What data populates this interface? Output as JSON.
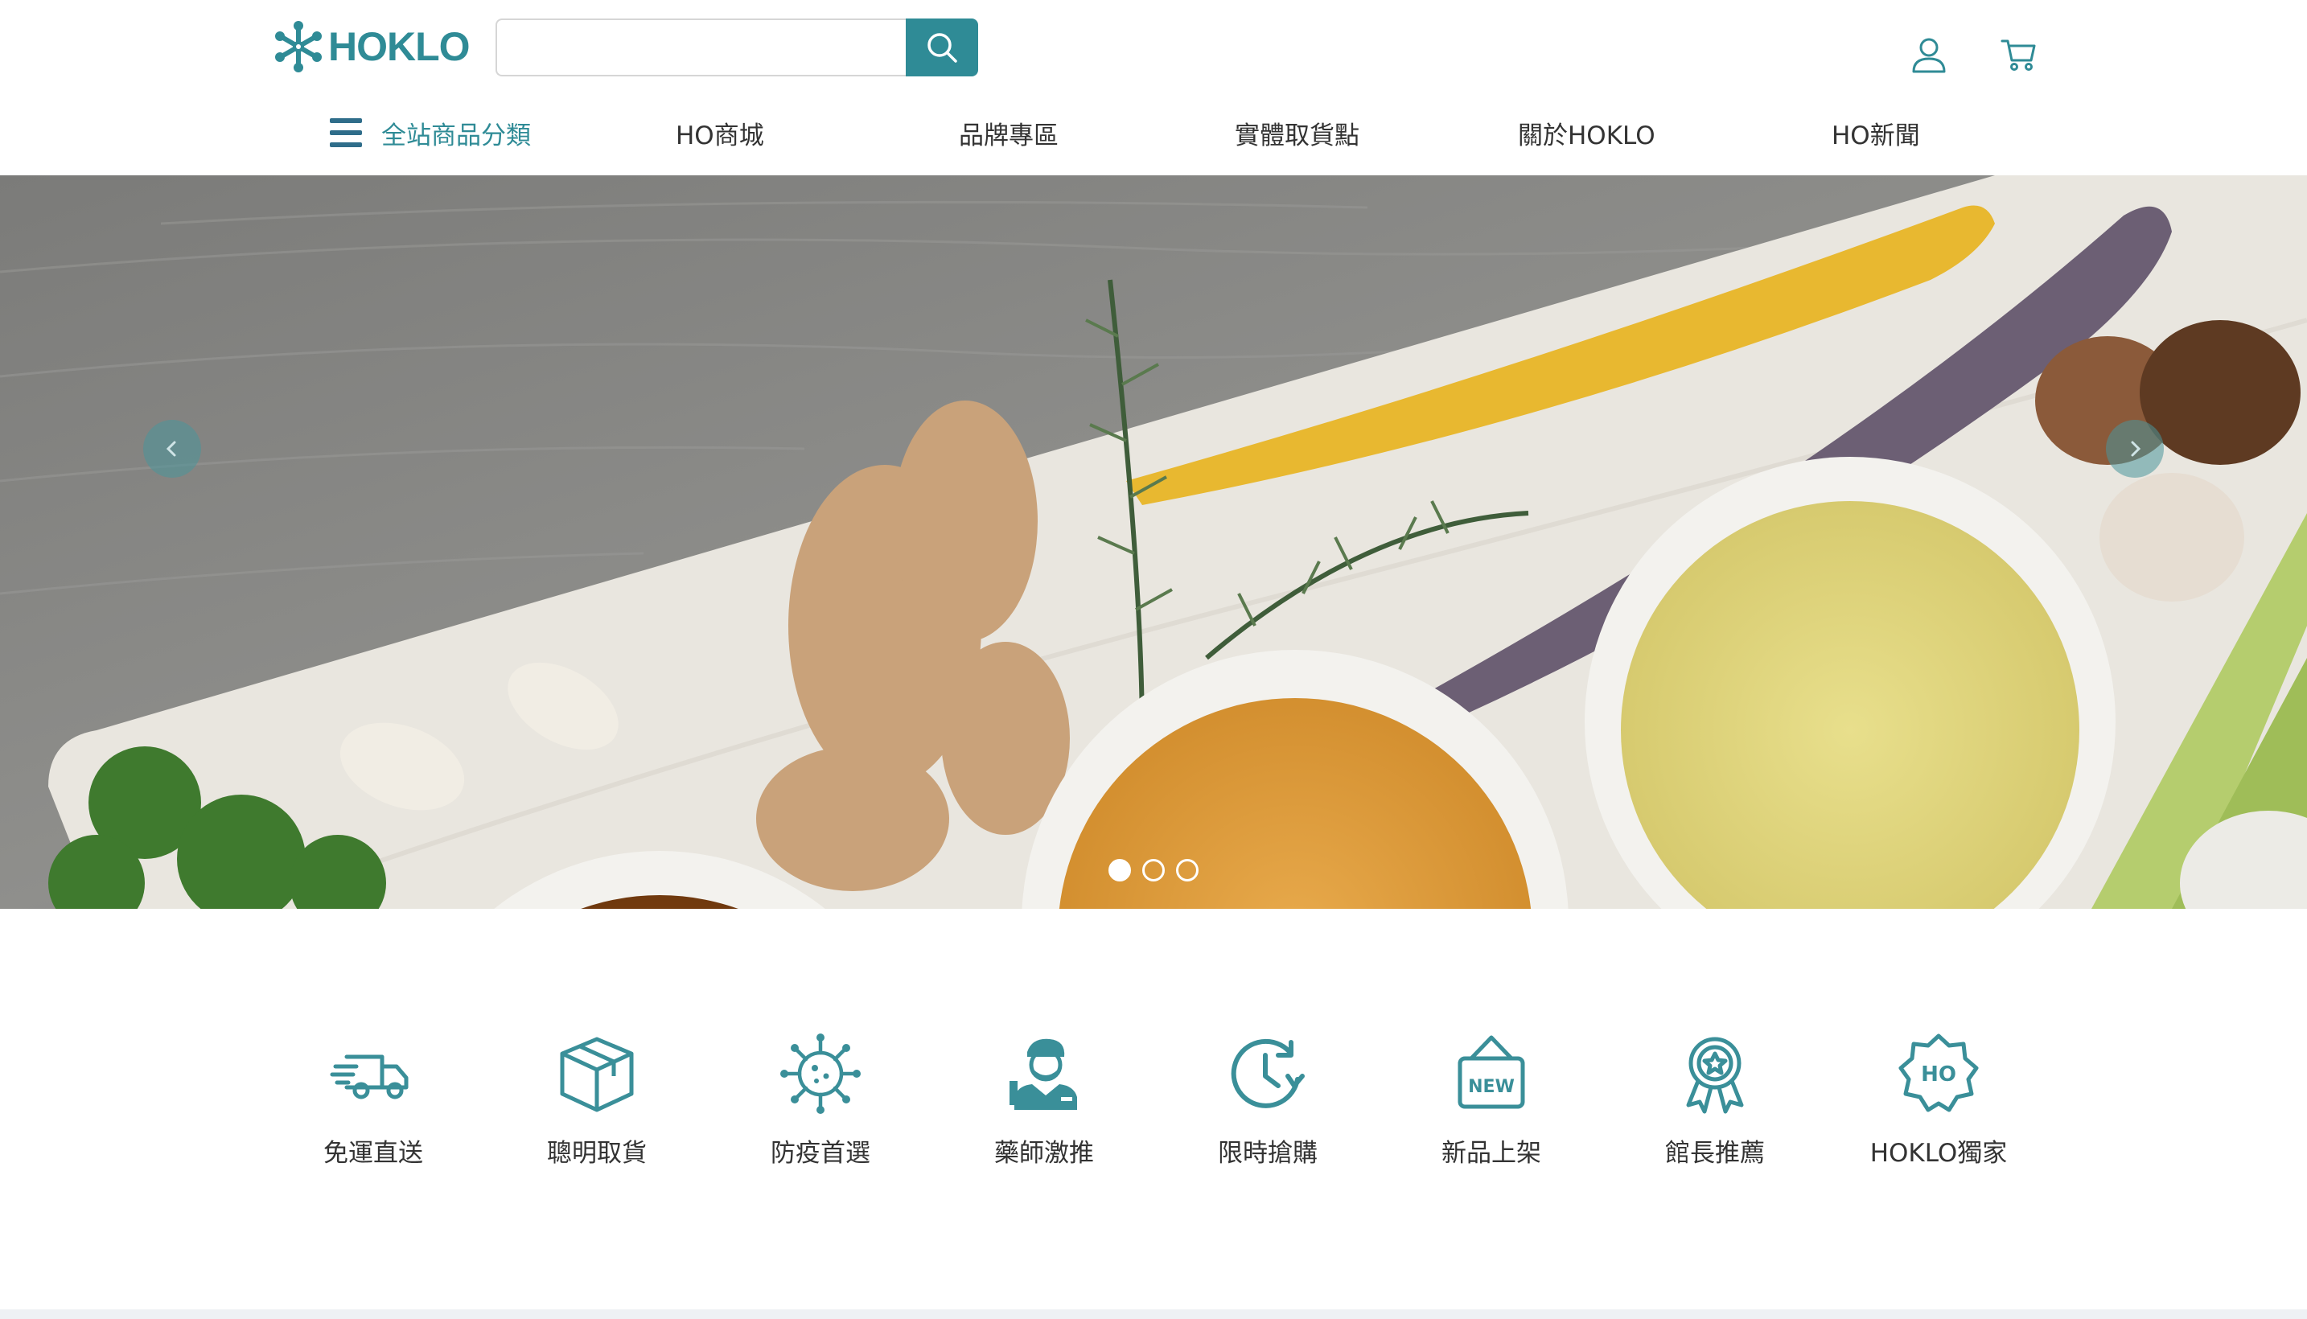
{
  "brand": {
    "name": "HOKLO",
    "accent": "#2f8b96"
  },
  "search": {
    "placeholder": "",
    "value": ""
  },
  "header_icons": [
    "user-icon",
    "cart-icon"
  ],
  "nav": {
    "categories_label": "全站商品分類",
    "items": [
      {
        "label": "HO商城"
      },
      {
        "label": "品牌專區"
      },
      {
        "label": "實體取貨點"
      },
      {
        "label": "關於HOKLO"
      },
      {
        "label": "HO新聞"
      }
    ]
  },
  "banner": {
    "slide_count": 3,
    "active_slide": 1
  },
  "features": [
    {
      "label": "免運直送",
      "icon": "delivery-truck-icon"
    },
    {
      "label": "聰明取貨",
      "icon": "package-box-icon"
    },
    {
      "label": "防疫首選",
      "icon": "virus-icon"
    },
    {
      "label": "藥師激推",
      "icon": "pharmacist-icon"
    },
    {
      "label": "限時搶購",
      "icon": "clock-icon"
    },
    {
      "label": "新品上架",
      "icon": "new-tag-icon"
    },
    {
      "label": "館長推薦",
      "icon": "award-ribbon-icon"
    },
    {
      "label": "HOKLO獨家",
      "icon": "ho-badge-icon"
    }
  ]
}
